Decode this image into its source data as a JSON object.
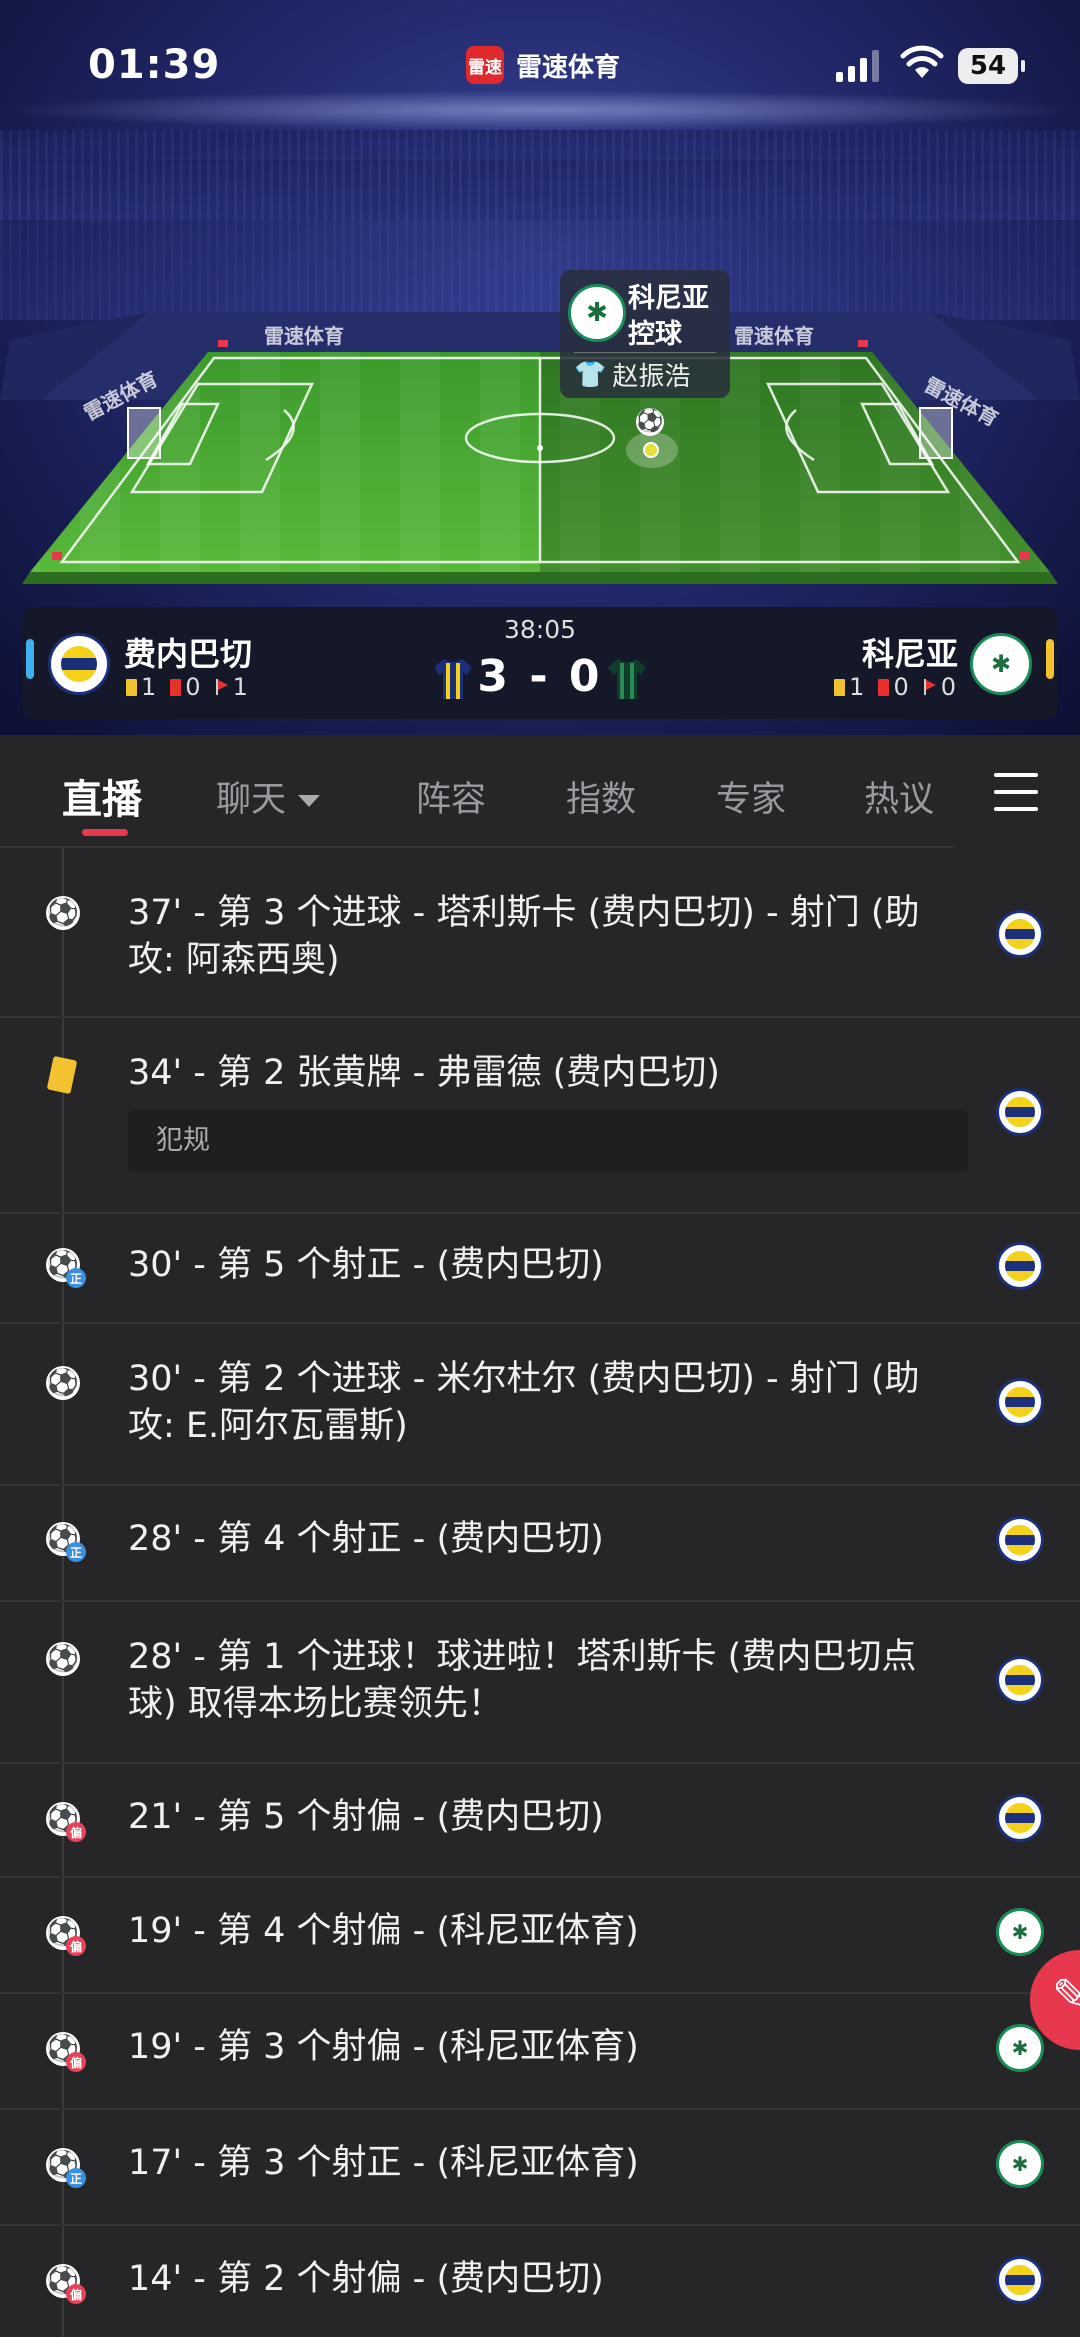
{
  "status_bar": {
    "time": "01:39",
    "battery": "54"
  },
  "app": {
    "logo_text": "雷速",
    "name": "雷速体育"
  },
  "pitch": {
    "board_text": "雷速体育"
  },
  "possession": {
    "team": "科尼亚",
    "action": "控球",
    "player": "赵振浩"
  },
  "match": {
    "time": "38:05",
    "score": "3 - 0",
    "home": {
      "name": "费内巴切",
      "yellow": "1",
      "red": "0",
      "corners": "1"
    },
    "away": {
      "name": "科尼亚",
      "yellow": "1",
      "red": "0",
      "corners": "0"
    }
  },
  "tabs": [
    {
      "label": "直播"
    },
    {
      "label": "聊天"
    },
    {
      "label": "阵容"
    },
    {
      "label": "指数"
    },
    {
      "label": "专家"
    },
    {
      "label": "热议"
    }
  ],
  "events": [
    {
      "type": "goal",
      "text": "37' - 第 3 个进球 - 塔利斯卡 (费内巴切) - 射门 (助攻: 阿森西奥)",
      "team": "fb"
    },
    {
      "type": "yellow",
      "text": "34' - 第 2 张黄牌 - 弗雷德 (费内巴切)",
      "note": "犯规",
      "team": "fb"
    },
    {
      "type": "shot_on",
      "text": "30' - 第 5 个射正 - (费内巴切)",
      "team": "fb",
      "sub": "正"
    },
    {
      "type": "goal",
      "text": "30' - 第 2 个进球 - 米尔杜尔 (费内巴切) - 射门 (助攻: E.阿尔瓦雷斯)",
      "team": "fb"
    },
    {
      "type": "shot_on",
      "text": "28' - 第 4 个射正 - (费内巴切)",
      "team": "fb",
      "sub": "正"
    },
    {
      "type": "goal",
      "text": "28' - 第 1 个进球！球进啦！塔利斯卡 (费内巴切点球) 取得本场比赛领先！",
      "team": "fb"
    },
    {
      "type": "shot_off",
      "text": "21' - 第 5 个射偏 - (费内巴切)",
      "team": "fb",
      "sub": "偏"
    },
    {
      "type": "shot_off",
      "text": "19' - 第 4 个射偏 - (科尼亚体育)",
      "team": "ko",
      "sub": "偏"
    },
    {
      "type": "shot_off",
      "text": "19' - 第 3 个射偏 - (科尼亚体育)",
      "team": "ko",
      "sub": "偏"
    },
    {
      "type": "shot_on",
      "text": "17' - 第 3 个射正 - (科尼亚体育)",
      "team": "ko",
      "sub": "正"
    },
    {
      "type": "shot_off",
      "text": "14' - 第 2 个射偏 - (费内巴切)",
      "team": "fb",
      "sub": "偏"
    }
  ]
}
